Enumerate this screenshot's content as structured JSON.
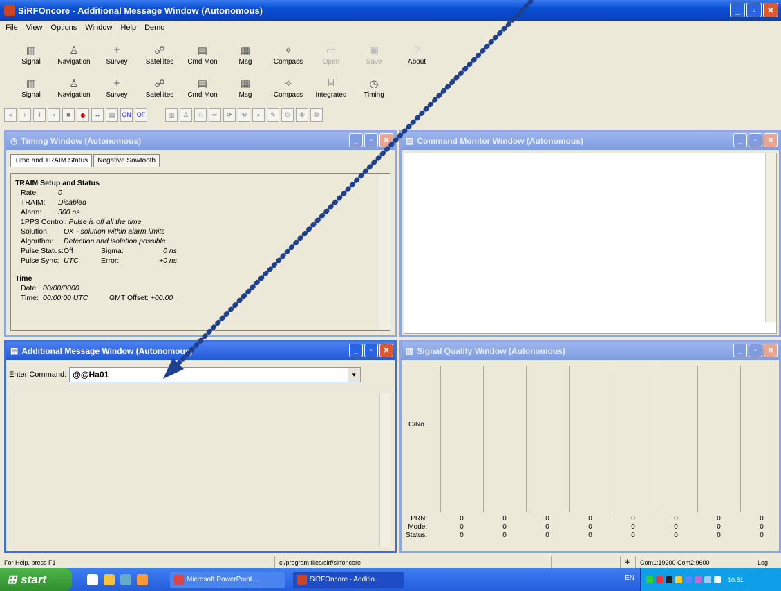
{
  "app": {
    "title": "SiRFOncore - Additional Message Window (Autonomous)"
  },
  "menu": [
    "File",
    "View",
    "Options",
    "Window",
    "Help",
    "Demo"
  ],
  "toolbar1": [
    {
      "label": "Signal",
      "icon": "signal-icon",
      "enabled": true
    },
    {
      "label": "Navigation",
      "icon": "navigation-icon",
      "enabled": true
    },
    {
      "label": "Survey",
      "icon": "survey-icon",
      "enabled": true
    },
    {
      "label": "Satellites",
      "icon": "satellites-icon",
      "enabled": true
    },
    {
      "label": "Cmd Mon",
      "icon": "cmd-mon-icon",
      "enabled": true
    },
    {
      "label": "Msg",
      "icon": "msg-icon",
      "enabled": true
    },
    {
      "label": "Compass",
      "icon": "compass-icon",
      "enabled": true
    },
    {
      "label": "Open",
      "icon": "open-icon",
      "enabled": false
    },
    {
      "label": "Save",
      "icon": "save-icon",
      "enabled": false
    },
    {
      "label": "About",
      "icon": "about-icon",
      "enabled": true
    }
  ],
  "toolbar2": [
    {
      "label": "Signal",
      "icon": "signal-icon"
    },
    {
      "label": "Navigation",
      "icon": "navigation-icon"
    },
    {
      "label": "Survey",
      "icon": "survey-icon"
    },
    {
      "label": "Satellites",
      "icon": "satellites-icon"
    },
    {
      "label": "Cmd Mon",
      "icon": "cmd-mon-icon"
    },
    {
      "label": "Msg",
      "icon": "msg-icon"
    },
    {
      "label": "Compass",
      "icon": "compass-icon"
    },
    {
      "label": "Integrated",
      "icon": "integrated-icon"
    },
    {
      "label": "Timing",
      "icon": "timing-icon"
    }
  ],
  "timing": {
    "title": "Timing Window (Autonomous)",
    "tabs": [
      "Time and TRAIM Status",
      "Negative Sawtooth"
    ],
    "traim_heading": "TRAIM Setup and Status",
    "rows": [
      {
        "k": "Rate:",
        "v": "0"
      },
      {
        "k": "TRAIM:",
        "v": "Disabled"
      },
      {
        "k": "Alarm:",
        "v": "300 ns"
      }
    ],
    "pps_label": "1PPS Control:",
    "pps_value": "Pulse is off all the time",
    "solution_label": "Solution:",
    "solution_value": "OK - solution within alarm limits",
    "algorithm_label": "Algorithm:",
    "algorithm_value": "Detection and isolation possible",
    "pulse_status_label": "Pulse Status:",
    "pulse_status_value": "Off",
    "sigma_label": "Sigma:",
    "sigma_value": "0 ns",
    "pulse_sync_label": "Pulse Sync:",
    "pulse_sync_value": "UTC",
    "error_label": "Error:",
    "error_value": "+0 ns",
    "time_heading": "Time",
    "date_label": "Date:",
    "date_value": "00/00/0000",
    "time_label": "Time:",
    "time_value": "00:00:00 UTC",
    "gmt_label": "GMT Offset:",
    "gmt_value": "+00:00"
  },
  "cmdmon": {
    "title": "Command Monitor Window (Autonomous)"
  },
  "addmsg": {
    "title": "Additional Message Window (Autonomous)",
    "enter_label": "Enter Command:",
    "command": "@@Ha01"
  },
  "sigq": {
    "title": "Signal Quality Window (Autonomous)",
    "cno_label": "C/No",
    "prn_label": "PRN:",
    "mode_label": "Mode:",
    "status_label": "Status:",
    "columns": [
      {
        "prn": "0",
        "mode": "0",
        "status": "0"
      },
      {
        "prn": "0",
        "mode": "0",
        "status": "0"
      },
      {
        "prn": "0",
        "mode": "0",
        "status": "0"
      },
      {
        "prn": "0",
        "mode": "0",
        "status": "0"
      },
      {
        "prn": "0",
        "mode": "0",
        "status": "0"
      },
      {
        "prn": "0",
        "mode": "0",
        "status": "0"
      },
      {
        "prn": "0",
        "mode": "0",
        "status": "0"
      },
      {
        "prn": "0",
        "mode": "0",
        "status": "0"
      }
    ]
  },
  "statusbar": {
    "help": "For Help, press F1",
    "path": "c:/program files/sirf/sirfoncore",
    "ports": "Com1:19200  Com2:9600",
    "log": "Log"
  },
  "taskbar": {
    "start": "start",
    "tasks": [
      "Microsoft PowerPoint ...",
      "SiRFOncore - Additio..."
    ],
    "lang": "EN",
    "clock": "10:51"
  },
  "colors": {
    "titlebar": "#0a4fd4",
    "arrow": "#1f3f8f",
    "face": "#ece9d8"
  }
}
